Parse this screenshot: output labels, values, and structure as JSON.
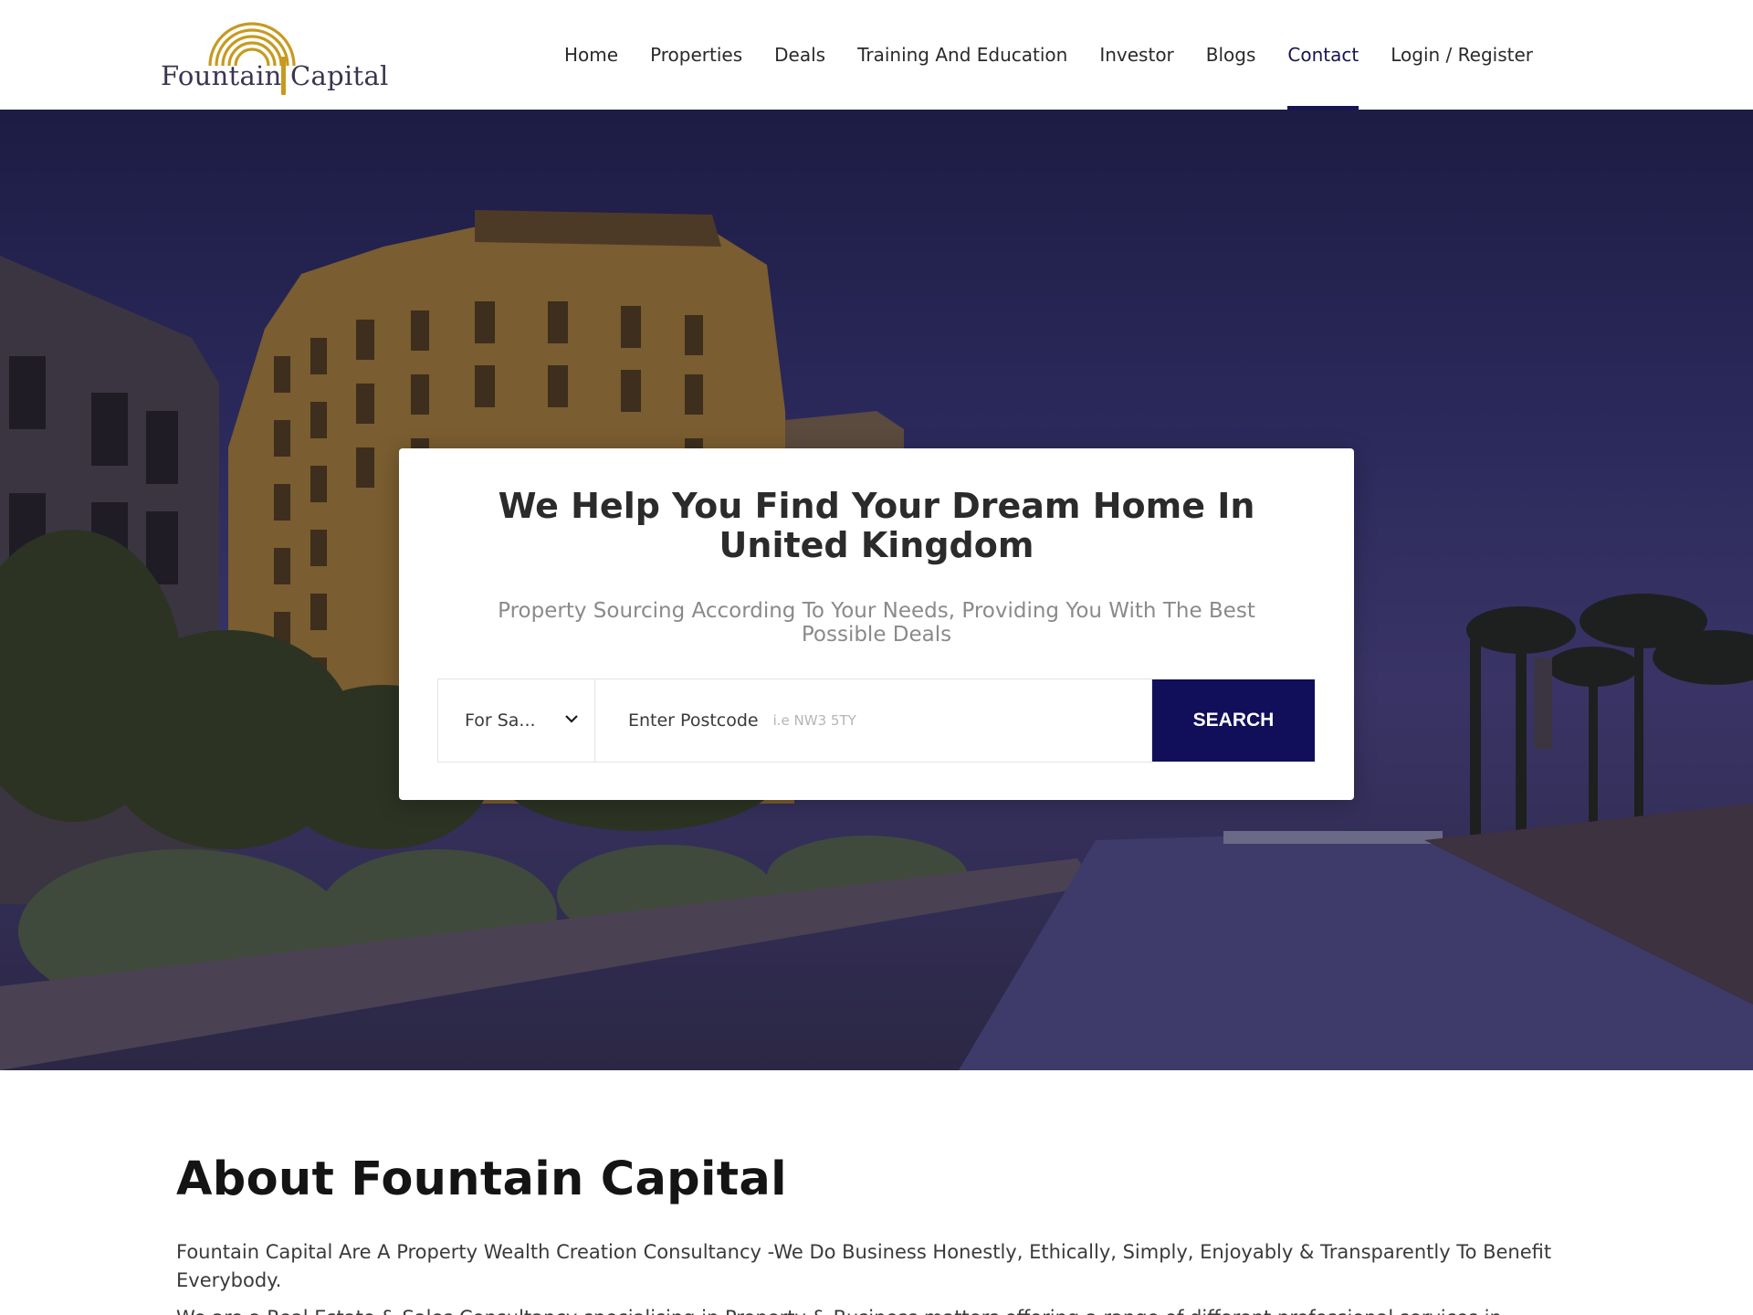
{
  "brand": {
    "name_left": "Fountain",
    "name_right": "Capital",
    "logo_color": "#c79a1f"
  },
  "nav": {
    "items": [
      {
        "label": "Home"
      },
      {
        "label": "Properties"
      },
      {
        "label": "Deals"
      },
      {
        "label": "Training And Education"
      },
      {
        "label": "Investor"
      },
      {
        "label": "Blogs"
      },
      {
        "label": "Contact",
        "active": true
      },
      {
        "label": "Login / Register"
      }
    ],
    "active_color": "#161452"
  },
  "hero": {
    "title": "We Help You Find Your Dream Home In United Kingdom",
    "subtitle": "Property Sourcing According To Your Needs, Providing You With The Best Possible Deals",
    "search": {
      "type_selected": "For Sa...",
      "postcode_label": "Enter Postcode",
      "postcode_placeholder": "i.e NW3 5TY",
      "button_label": "SEARCH",
      "button_color": "#110e5a"
    }
  },
  "about": {
    "title": "About Fountain Capital",
    "paragraph": "Fountain Capital Are A Property Wealth Creation Consultancy -We Do Business Honestly, Ethically, Simply, Enjoyably & Transparently To Benefit Everybody.",
    "paragraph2_partial": "We are a Real Estate & Sales Consultancy specialising in Property & Business matters offering a range of different professional services in"
  }
}
